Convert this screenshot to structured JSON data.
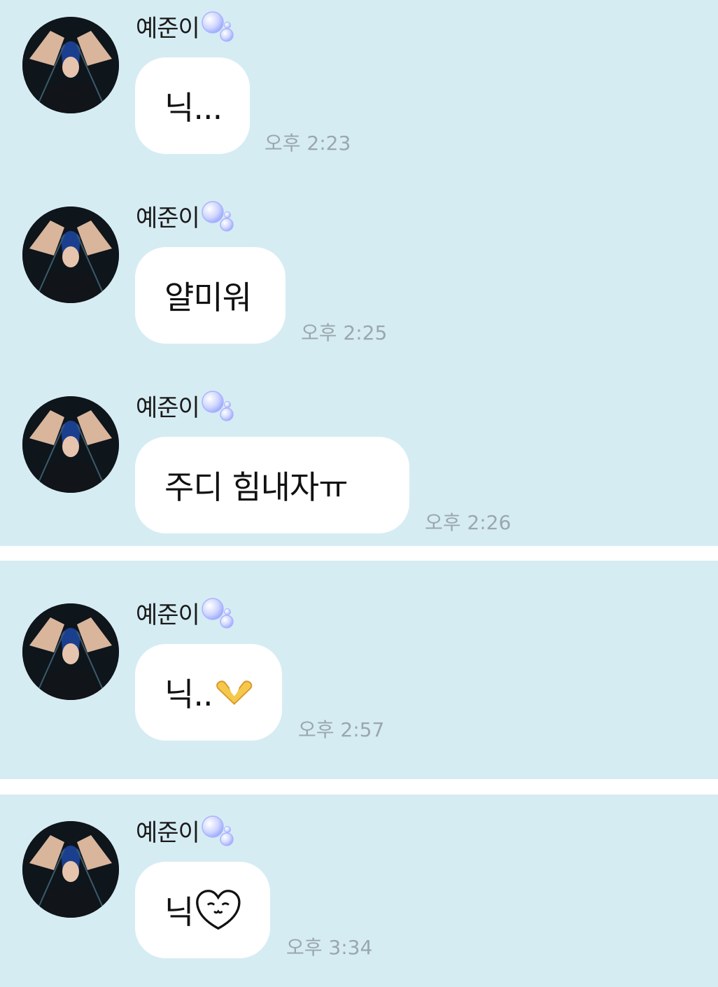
{
  "messages": [
    {
      "sender": "예준이",
      "text": "닉...",
      "time": "오후 2:23"
    },
    {
      "sender": "예준이",
      "text": "얄미워",
      "time": "오후 2:25"
    },
    {
      "sender": "예준이",
      "text": "주디 힘내자ㅠ",
      "time": "오후 2:26"
    },
    {
      "sender": "예준이",
      "text": "닉..",
      "emoji": "heart-hands-emoji",
      "time": "오후 2:57"
    },
    {
      "sender": "예준이",
      "text": "닉",
      "emoji": "smiling-heart-face-icon",
      "time": "오후 3:34"
    }
  ],
  "colors": {
    "background": "#d6ecf3",
    "bubble": "#ffffff",
    "timestamp": "#9aa7ad",
    "separator": "#ffffff"
  }
}
